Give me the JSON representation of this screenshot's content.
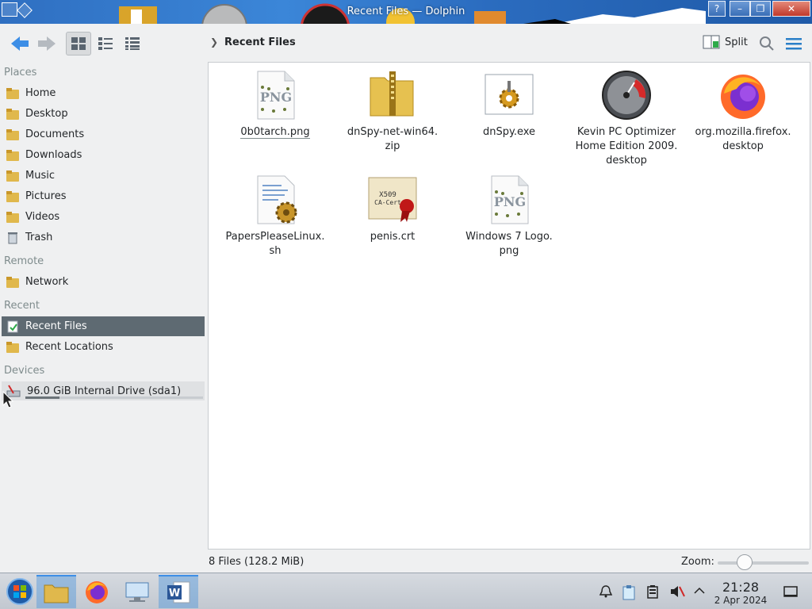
{
  "window": {
    "title": "Recent Files — Dolphin"
  },
  "toolbar": {
    "back_icon": "arrow-left-icon",
    "forward_icon": "arrow-right-icon",
    "breadcrumb": "Recent Files",
    "split_label": "Split",
    "search_icon": "search-icon",
    "menu_icon": "hamburger-menu-icon"
  },
  "sidebar": {
    "sections": {
      "places": "Places",
      "remote": "Remote",
      "recent": "Recent",
      "devices": "Devices"
    },
    "places": [
      {
        "label": "Home",
        "icon": "home-folder-icon"
      },
      {
        "label": "Desktop",
        "icon": "desktop-folder-icon"
      },
      {
        "label": "Documents",
        "icon": "documents-folder-icon"
      },
      {
        "label": "Downloads",
        "icon": "downloads-folder-icon"
      },
      {
        "label": "Music",
        "icon": "music-folder-icon"
      },
      {
        "label": "Pictures",
        "icon": "pictures-folder-icon"
      },
      {
        "label": "Videos",
        "icon": "videos-folder-icon"
      },
      {
        "label": "Trash",
        "icon": "trash-icon"
      }
    ],
    "remote": [
      {
        "label": "Network",
        "icon": "network-folder-icon"
      }
    ],
    "recent": [
      {
        "label": "Recent Files",
        "icon": "recent-files-icon",
        "selected": true
      },
      {
        "label": "Recent Locations",
        "icon": "recent-locations-icon"
      }
    ],
    "devices": [
      {
        "label": "96.0 GiB Internal Drive (sda1)",
        "icon": "hard-drive-icon",
        "usage_fraction": 0.19
      }
    ]
  },
  "files": [
    {
      "name": "0b0tarch.png",
      "icon": "png-image-icon"
    },
    {
      "name": "dnSpy-net-win64.zip",
      "icon": "zip-folder-icon"
    },
    {
      "name": "dnSpy.exe",
      "icon": "exe-gear-icon"
    },
    {
      "name": "Kevin PC Optimizer Home Edition 2009.desktop",
      "icon": "speedometer-icon"
    },
    {
      "name": "org.mozilla.firefox.desktop",
      "icon": "firefox-icon"
    },
    {
      "name": "PapersPleaseLinux.sh",
      "icon": "shell-script-icon"
    },
    {
      "name": "penis.crt",
      "icon": "certificate-icon"
    },
    {
      "name": "Windows 7 Logo.png",
      "icon": "png-image-icon"
    }
  ],
  "file_names_wrapped": [
    [
      "0b0tarch.png"
    ],
    [
      "dnSpy-net-win64.",
      "zip"
    ],
    [
      "dnSpy.exe"
    ],
    [
      "Kevin PC Optimizer",
      "Home Edition 2009.",
      "desktop"
    ],
    [
      "org.mozilla.firefox.",
      "desktop"
    ],
    [
      "PapersPleaseLinux.",
      "sh"
    ],
    [
      "penis.crt"
    ],
    [
      "Windows 7 Logo.",
      "png"
    ]
  ],
  "statusbar": {
    "summary": "8 Files (128.2 MiB)",
    "zoom_label": "Zoom:",
    "zoom_level": 0.25
  },
  "taskbar": {
    "apps": [
      "start-orb-icon",
      "file-manager-icon",
      "firefox-icon",
      "system-monitor-icon",
      "word-icon"
    ],
    "tray": [
      "notifications-icon",
      "clipboard-icon",
      "battery-icon",
      "muted-speaker-icon",
      "chevron-up-icon",
      "show-desktop-icon"
    ],
    "time": "21:28",
    "date": "2 Apr 2024"
  },
  "colors": {
    "selection": "#5e6a72",
    "accent": "#3daee9",
    "folder": "#e0b84c"
  }
}
